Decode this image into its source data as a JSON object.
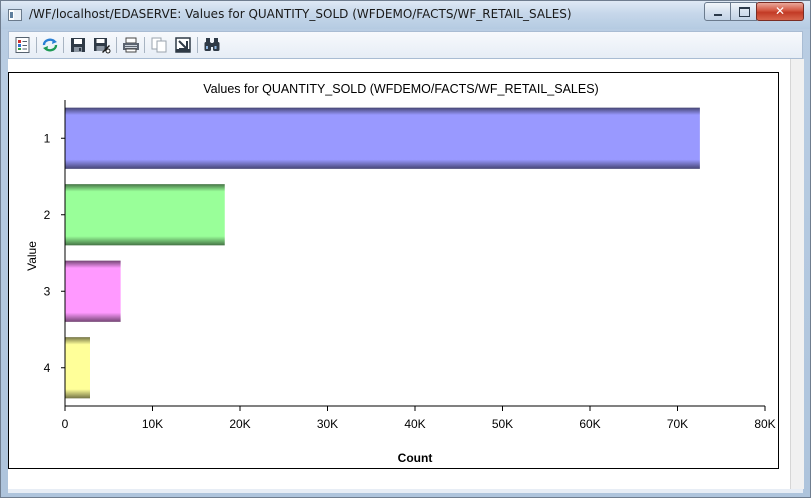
{
  "window": {
    "title": "/WF/localhost/EDASERVE: Values for QUANTITY_SOLD (WFDEMO/FACTS/WF_RETAIL_SALES)",
    "close_glyph": "✕"
  },
  "toolbar": {
    "buttons": [
      {
        "name": "properties",
        "icon": "chart-properties-icon"
      },
      {
        "name": "refresh",
        "icon": "refresh-icon"
      },
      {
        "name": "save",
        "icon": "save-icon"
      },
      {
        "name": "save-as",
        "icon": "save-as-icon"
      },
      {
        "name": "print",
        "icon": "print-icon"
      },
      {
        "name": "copy",
        "icon": "copy-icon"
      },
      {
        "name": "export",
        "icon": "export-icon"
      },
      {
        "name": "find",
        "icon": "binoculars-icon"
      }
    ]
  },
  "chart_data": {
    "type": "bar",
    "orientation": "horizontal",
    "title": "Values for QUANTITY_SOLD (WFDEMO/FACTS/WF_RETAIL_SALES)",
    "xlabel": "Count",
    "ylabel": "Value",
    "categories": [
      "1",
      "2",
      "3",
      "4"
    ],
    "values": [
      72500,
      18200,
      6300,
      2800
    ],
    "xlim": [
      0,
      80000
    ],
    "x_ticks": [
      0,
      10000,
      20000,
      30000,
      40000,
      50000,
      60000,
      70000,
      80000
    ],
    "x_tick_labels": [
      "0",
      "10K",
      "20K",
      "30K",
      "40K",
      "50K",
      "60K",
      "70K",
      "80K"
    ],
    "colors": [
      "#9999ff",
      "#99ff99",
      "#ff99ff",
      "#ffff99"
    ],
    "grid": false,
    "legend": false
  }
}
